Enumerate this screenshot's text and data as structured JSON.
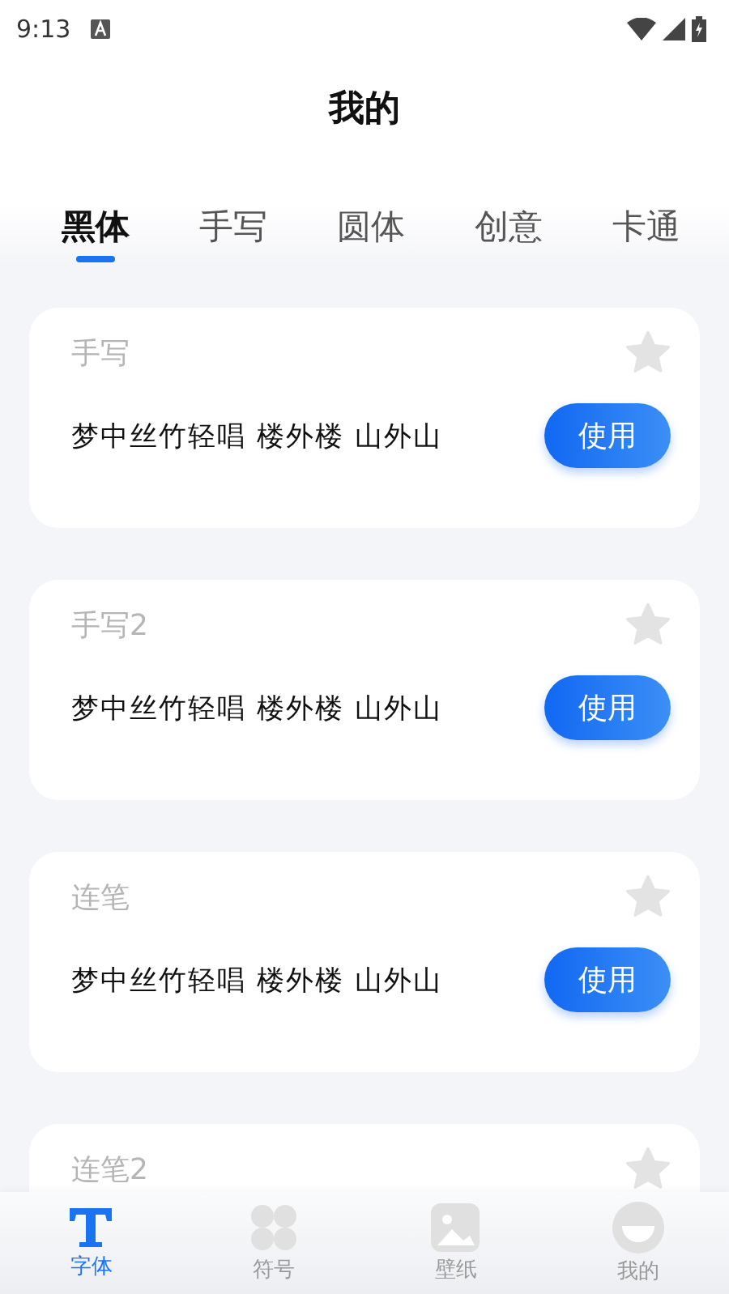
{
  "status_bar": {
    "time": "9:13"
  },
  "title": "我的",
  "tabs": [
    {
      "label": "黑体",
      "selected": true
    },
    {
      "label": "手写",
      "selected": false
    },
    {
      "label": "圆体",
      "selected": false
    },
    {
      "label": "创意",
      "selected": false
    },
    {
      "label": "卡通",
      "selected": false
    }
  ],
  "fonts": [
    {
      "name": "手写",
      "favorite": false,
      "sample": "梦中丝竹轻唱 楼外楼 山外山",
      "button": "使用"
    },
    {
      "name": "手写2",
      "favorite": false,
      "sample": "梦中丝竹轻唱 楼外楼 山外山",
      "button": "使用"
    },
    {
      "name": "连笔",
      "favorite": false,
      "sample": "梦中丝竹轻唱 楼外楼 山外山",
      "button": "使用"
    },
    {
      "name": "连笔2",
      "favorite": false
    }
  ],
  "nav": [
    {
      "label": "字体",
      "kind": "font",
      "selected": true
    },
    {
      "label": "符号",
      "kind": "symbol",
      "selected": false
    },
    {
      "label": "壁纸",
      "kind": "wallpaper",
      "selected": false
    },
    {
      "label": "我的",
      "kind": "profile",
      "selected": false
    }
  ]
}
